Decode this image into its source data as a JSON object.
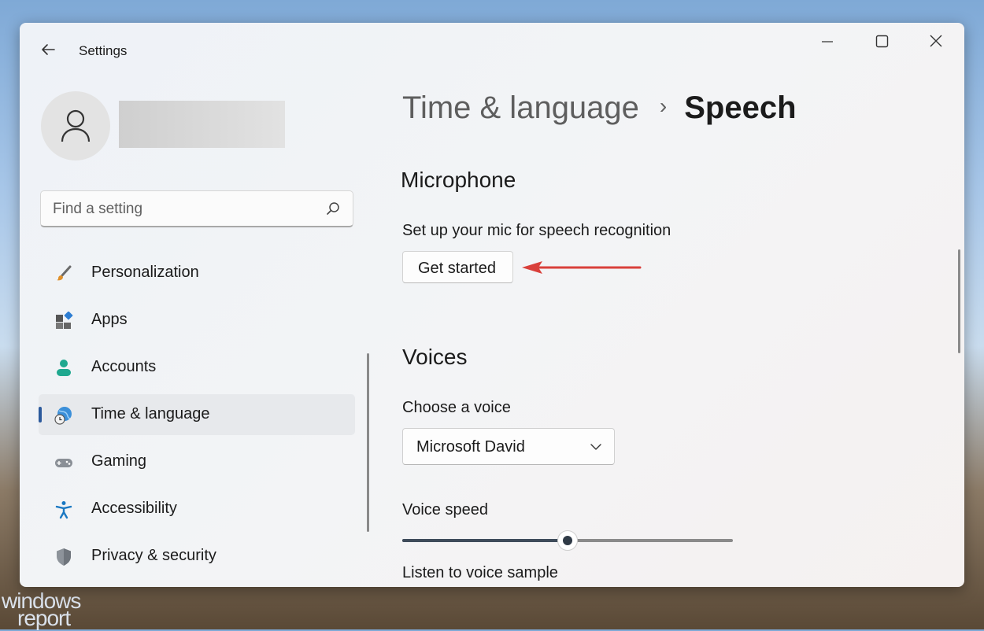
{
  "window": {
    "title": "Settings",
    "controls": {
      "minimize": "minimize-icon",
      "maximize": "maximize-icon",
      "close": "close-icon"
    }
  },
  "search": {
    "placeholder": "Find a setting",
    "icon": "search-icon"
  },
  "sidebar": {
    "items": [
      {
        "label": "Personalization",
        "icon": "brush-icon"
      },
      {
        "label": "Apps",
        "icon": "apps-icon"
      },
      {
        "label": "Accounts",
        "icon": "person-icon"
      },
      {
        "label": "Time & language",
        "icon": "globe-clock-icon",
        "active": true
      },
      {
        "label": "Gaming",
        "icon": "gamepad-icon"
      },
      {
        "label": "Accessibility",
        "icon": "accessibility-icon"
      },
      {
        "label": "Privacy & security",
        "icon": "shield-icon"
      }
    ]
  },
  "breadcrumb": {
    "parent": "Time & language",
    "separator": "›",
    "current": "Speech"
  },
  "microphone": {
    "heading": "Microphone",
    "description": "Set up your mic for speech recognition",
    "button_label": "Get started"
  },
  "voices": {
    "heading": "Voices",
    "choose_label": "Choose a voice",
    "selected_voice": "Microsoft David",
    "speed_label": "Voice speed",
    "speed_value": 0.5,
    "sample_label": "Listen to voice sample"
  },
  "watermark": {
    "line1": "windows",
    "line2": "report"
  },
  "colors": {
    "accent": "#2c5a9c",
    "annotation_arrow": "#d9403b"
  }
}
